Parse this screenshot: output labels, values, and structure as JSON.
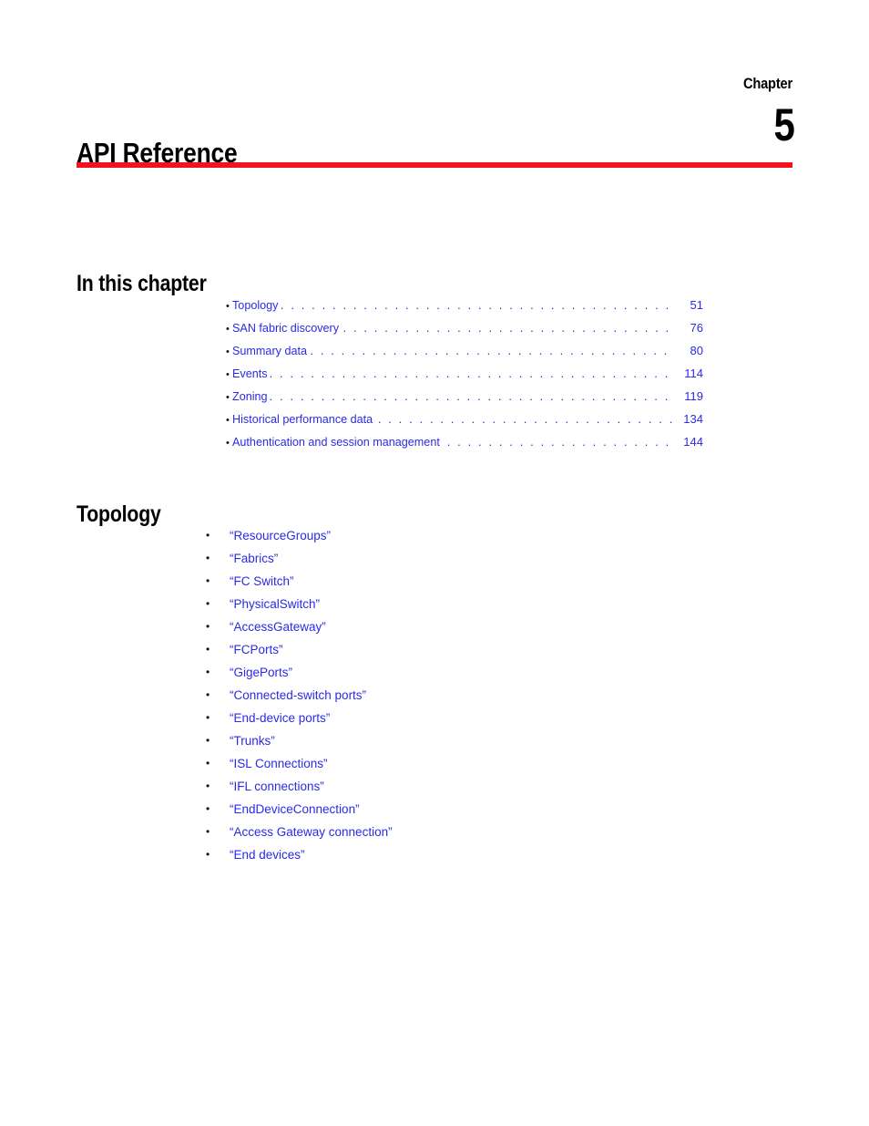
{
  "header": {
    "chapter_label": "Chapter",
    "chapter_number": "5",
    "title": "API Reference",
    "rule_color": "#f5121d"
  },
  "colors": {
    "link": "#2a2ae8",
    "text": "#000000",
    "rule": "#f5121d"
  },
  "in_this_chapter": {
    "heading": "In this chapter",
    "entries": [
      {
        "bullet": "•",
        "label": "Topology",
        "page": "51"
      },
      {
        "bullet": "•",
        "label": "SAN fabric discovery",
        "page": "76"
      },
      {
        "bullet": "•",
        "label": "Summary data",
        "page": "80"
      },
      {
        "bullet": "•",
        "label": "Events",
        "page": "114"
      },
      {
        "bullet": "•",
        "label": "Zoning",
        "page": "119"
      },
      {
        "bullet": "•",
        "label": "Historical performance data",
        "page": "134"
      },
      {
        "bullet": "•",
        "label": "Authentication and session management",
        "page": "144"
      }
    ],
    "leader": ". . . . . . . . . . . . . . . . . . . . . . . . . . . . . . . . . . . . . . . . . . . . . . . . . . . . . . . . . . . . . . . . . . . . . . . . . . . . . . . . ."
  },
  "topology": {
    "heading": "Topology",
    "items": [
      {
        "bullet": "•",
        "label": "“ResourceGroups”"
      },
      {
        "bullet": "•",
        "label": "“Fabrics”"
      },
      {
        "bullet": "•",
        "label": "“FC Switch”"
      },
      {
        "bullet": "•",
        "label": "“PhysicalSwitch”"
      },
      {
        "bullet": "•",
        "label": "“AccessGateway”"
      },
      {
        "bullet": "•",
        "label": "“FCPorts”"
      },
      {
        "bullet": "•",
        "label": "“GigePorts”"
      },
      {
        "bullet": "•",
        "label": "“Connected-switch ports”"
      },
      {
        "bullet": "•",
        "label": "“End-device ports”"
      },
      {
        "bullet": "•",
        "label": "“Trunks”"
      },
      {
        "bullet": "•",
        "label": "“ISL Connections”"
      },
      {
        "bullet": "•",
        "label": "“IFL connections”"
      },
      {
        "bullet": "•",
        "label": "“EndDeviceConnection”"
      },
      {
        "bullet": "•",
        "label": "“Access Gateway connection”"
      },
      {
        "bullet": "•",
        "label": "“End devices”"
      }
    ]
  }
}
